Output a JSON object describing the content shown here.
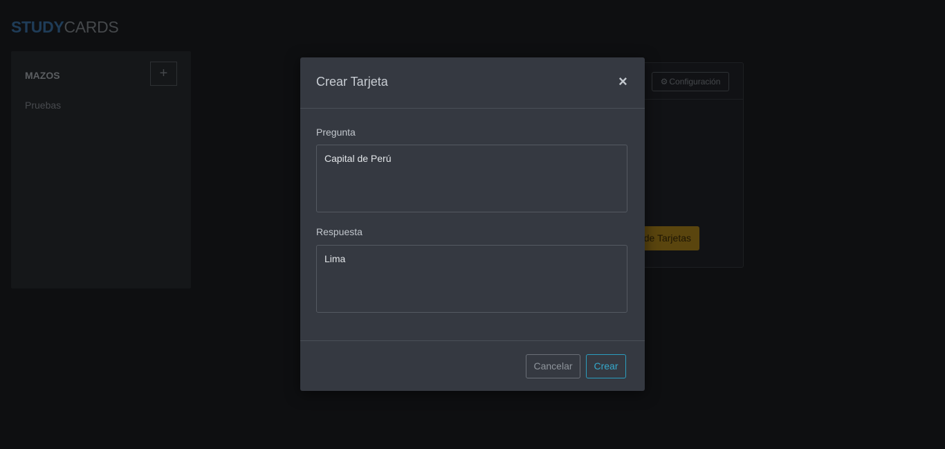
{
  "brand": {
    "part1": "STUDY",
    "part2": "CARDS"
  },
  "sidebar": {
    "title": "MAZOS",
    "add_icon": "+",
    "decks": [
      {
        "label": "Pruebas"
      }
    ]
  },
  "card_panel": {
    "config_icon": "⚙",
    "config_label": "Configuración",
    "study_label": "de Tarjetas"
  },
  "modal": {
    "title": "Crear Tarjeta",
    "close_icon": "×",
    "question_label": "Pregunta",
    "question_value": "Capital de Perú",
    "answer_label": "Respuesta",
    "answer_value": "Lima",
    "cancel_label": "Cancelar",
    "create_label": "Crear"
  },
  "colors": {
    "brand_accent": "#3f79b0",
    "primary_outline": "#2b9fc0",
    "warning": "#b58a1c"
  }
}
